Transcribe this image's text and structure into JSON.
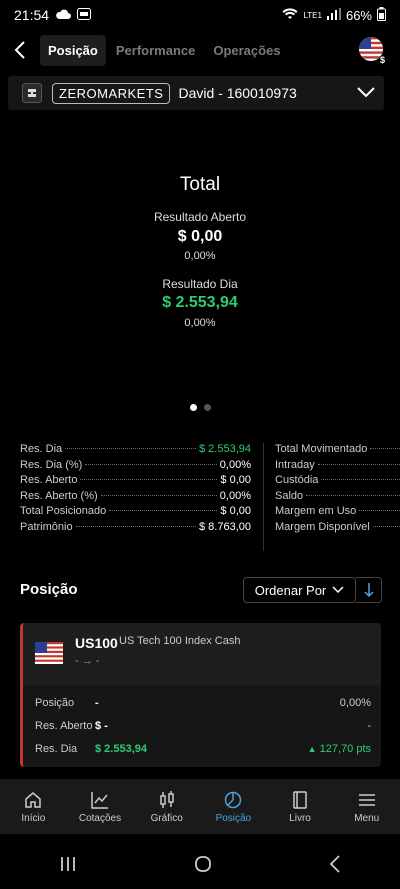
{
  "status": {
    "time": "21:54",
    "battery": "66%",
    "network": "LTE1"
  },
  "tabs": [
    {
      "label": "Posição",
      "active": true
    },
    {
      "label": "Performance",
      "active": false
    },
    {
      "label": "Operações",
      "active": false
    }
  ],
  "account": {
    "broker": "ZEROMARKETS",
    "name": "David - 160010973"
  },
  "summary": {
    "title": "Total",
    "open_label": "Resultado Aberto",
    "open_value": "$ 0,00",
    "open_pct": "0,00%",
    "day_label": "Resultado Dia",
    "day_value": "$ 2.553,94",
    "day_pct": "0,00%"
  },
  "stats_left": [
    {
      "label": "Res. Dia",
      "value": "$ 2.553,94",
      "color": "#2ecc71"
    },
    {
      "label": "Res. Dia (%)",
      "value": "0,00%"
    },
    {
      "label": "Res. Aberto",
      "value": "$ 0,00"
    },
    {
      "label": "Res. Aberto (%)",
      "value": "0,00%"
    },
    {
      "label": "Total Posicionado",
      "value": "$ 0,00"
    },
    {
      "label": "Patrimônio",
      "value": "$ 8.763,00"
    }
  ],
  "stats_right": [
    {
      "label": "Total Movimentado"
    },
    {
      "label": "Intraday"
    },
    {
      "label": "Custódia"
    },
    {
      "label": "Saldo"
    },
    {
      "label": "Margem em Uso"
    },
    {
      "label": "Margem Disponível"
    }
  ],
  "position_section": {
    "title": "Posição",
    "sort_label": "Ordenar Por"
  },
  "position_card": {
    "symbol": "US100",
    "description": "US Tech 100 Index Cash",
    "sub": "-  →  -",
    "rows": [
      {
        "label": "Posição",
        "value": "-",
        "right": "0,00%"
      },
      {
        "label": "Res. Aberto",
        "value": "$ -",
        "right": "-"
      },
      {
        "label": "Res. Dia",
        "value": "$ 2.553,94",
        "right": "127,70 pts"
      }
    ],
    "accent": "#c0392b"
  },
  "bottom_nav": [
    {
      "label": "Início",
      "icon": "home-icon"
    },
    {
      "label": "Cotações",
      "icon": "chart-line-icon"
    },
    {
      "label": "Gráfico",
      "icon": "candlestick-icon"
    },
    {
      "label": "Posição",
      "icon": "pie-icon",
      "active": true
    },
    {
      "label": "Livro",
      "icon": "book-icon"
    },
    {
      "label": "Menu",
      "icon": "menu-icon"
    }
  ],
  "colors": {
    "positive": "#2ecc71",
    "accent_active": "#4aa3df",
    "card_border": "#c0392b"
  }
}
